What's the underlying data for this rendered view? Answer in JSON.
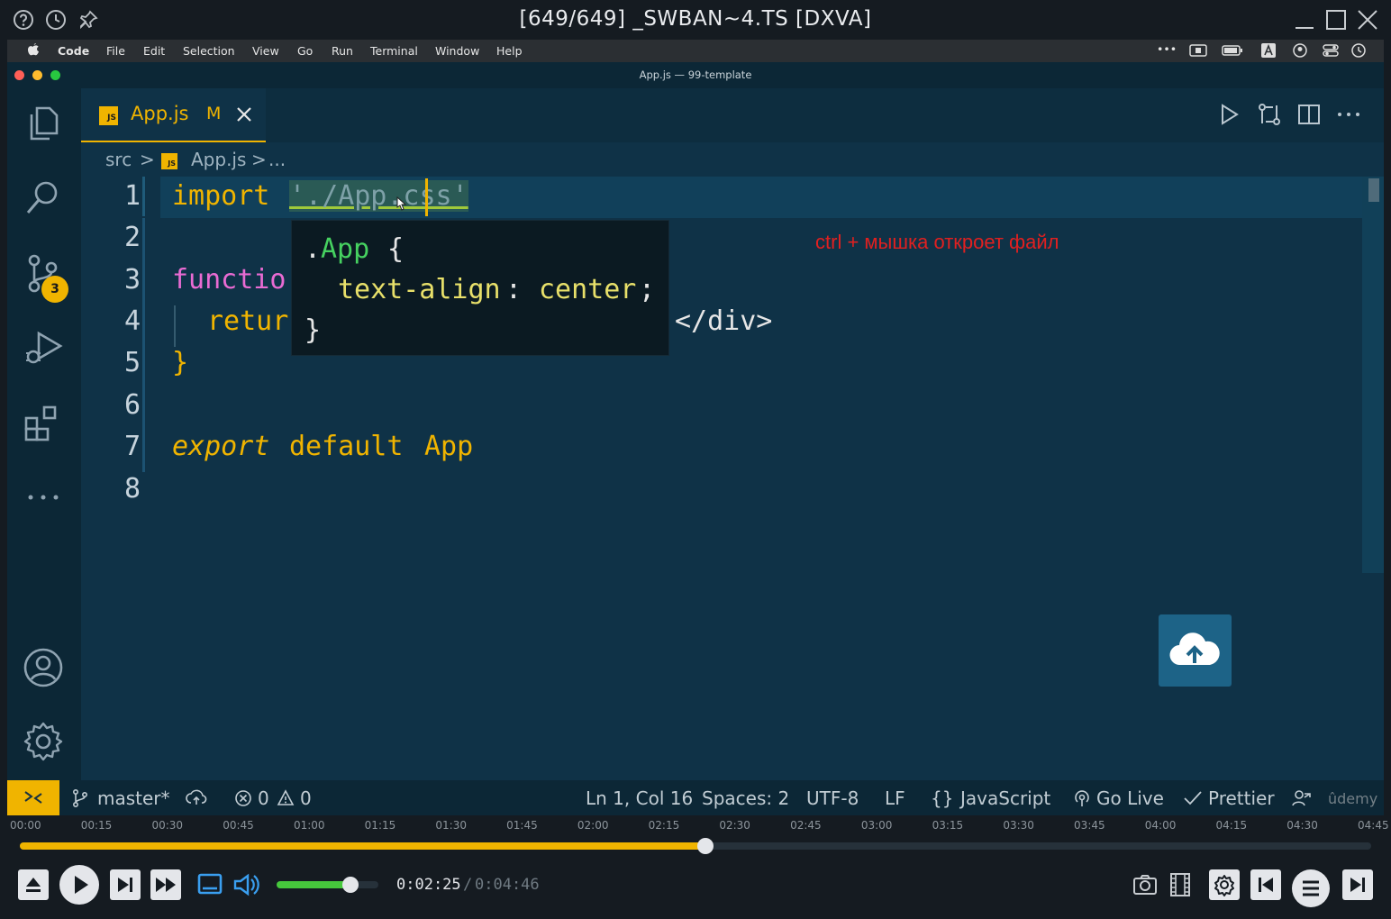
{
  "player": {
    "title": "[649/649] _SWBAN~4.TS [DXVA]",
    "time_current": "0:02:25",
    "time_separator": "/",
    "time_total": "0:04:46",
    "progress_fraction": 0.507,
    "volume_fraction": 0.73,
    "timeline_labels": [
      "00:00",
      "00:15",
      "00:30",
      "00:45",
      "01:00",
      "01:15",
      "01:30",
      "01:45",
      "02:00",
      "02:15",
      "02:30",
      "02:45",
      "03:00",
      "03:15",
      "03:30",
      "03:45",
      "04:00",
      "04:15",
      "04:30",
      "04:45"
    ]
  },
  "mac_menu": {
    "apple": "",
    "items": [
      "Code",
      "File",
      "Edit",
      "Selection",
      "View",
      "Go",
      "Run",
      "Terminal",
      "Window",
      "Help"
    ],
    "more": "•••"
  },
  "window_title": "App.js — 99-template",
  "tab": {
    "label": "App.js",
    "badge": "JS",
    "status": "M"
  },
  "breadcrumb": {
    "folder": "src",
    "sep": ">",
    "file": "App.js",
    "more": "..."
  },
  "activity": {
    "scm_badge": "3"
  },
  "editor": {
    "line_numbers": [
      "1",
      "2",
      "3",
      "4",
      "5",
      "6",
      "7",
      "8"
    ],
    "line1_keyword": "import",
    "line1_string": "'./App.css'",
    "line3": "functio",
    "line4": "retur",
    "line4_tail": "</div>",
    "line5": "}",
    "line7_export": "export",
    "line7_default": "default",
    "line7_name": "App"
  },
  "hover": {
    "selector_dot": ".",
    "selector_name": "App",
    "open_brace": "{",
    "property": "text-align",
    "colon": ":",
    "value": "center",
    "semicolon": ";",
    "close_brace": "}"
  },
  "annotation": "ctrl + мышка откроет файл",
  "status": {
    "branch": "master*",
    "errors": "0",
    "warnings": "0",
    "position": "Ln 1, Col 16",
    "spaces": "Spaces: 2",
    "encoding": "UTF-8",
    "eol": "LF",
    "language_braces": "{}",
    "language": "JavaScript",
    "go_live": "Go Live",
    "prettier": "Prettier",
    "watermark": "ûdemy"
  },
  "colors": {
    "accent": "#f0b400",
    "editor_bg": "#0f3247",
    "keyword": "#f0b400",
    "string": "#a0c93a",
    "annotation": "#e02020",
    "upload_button": "#1d6387"
  }
}
